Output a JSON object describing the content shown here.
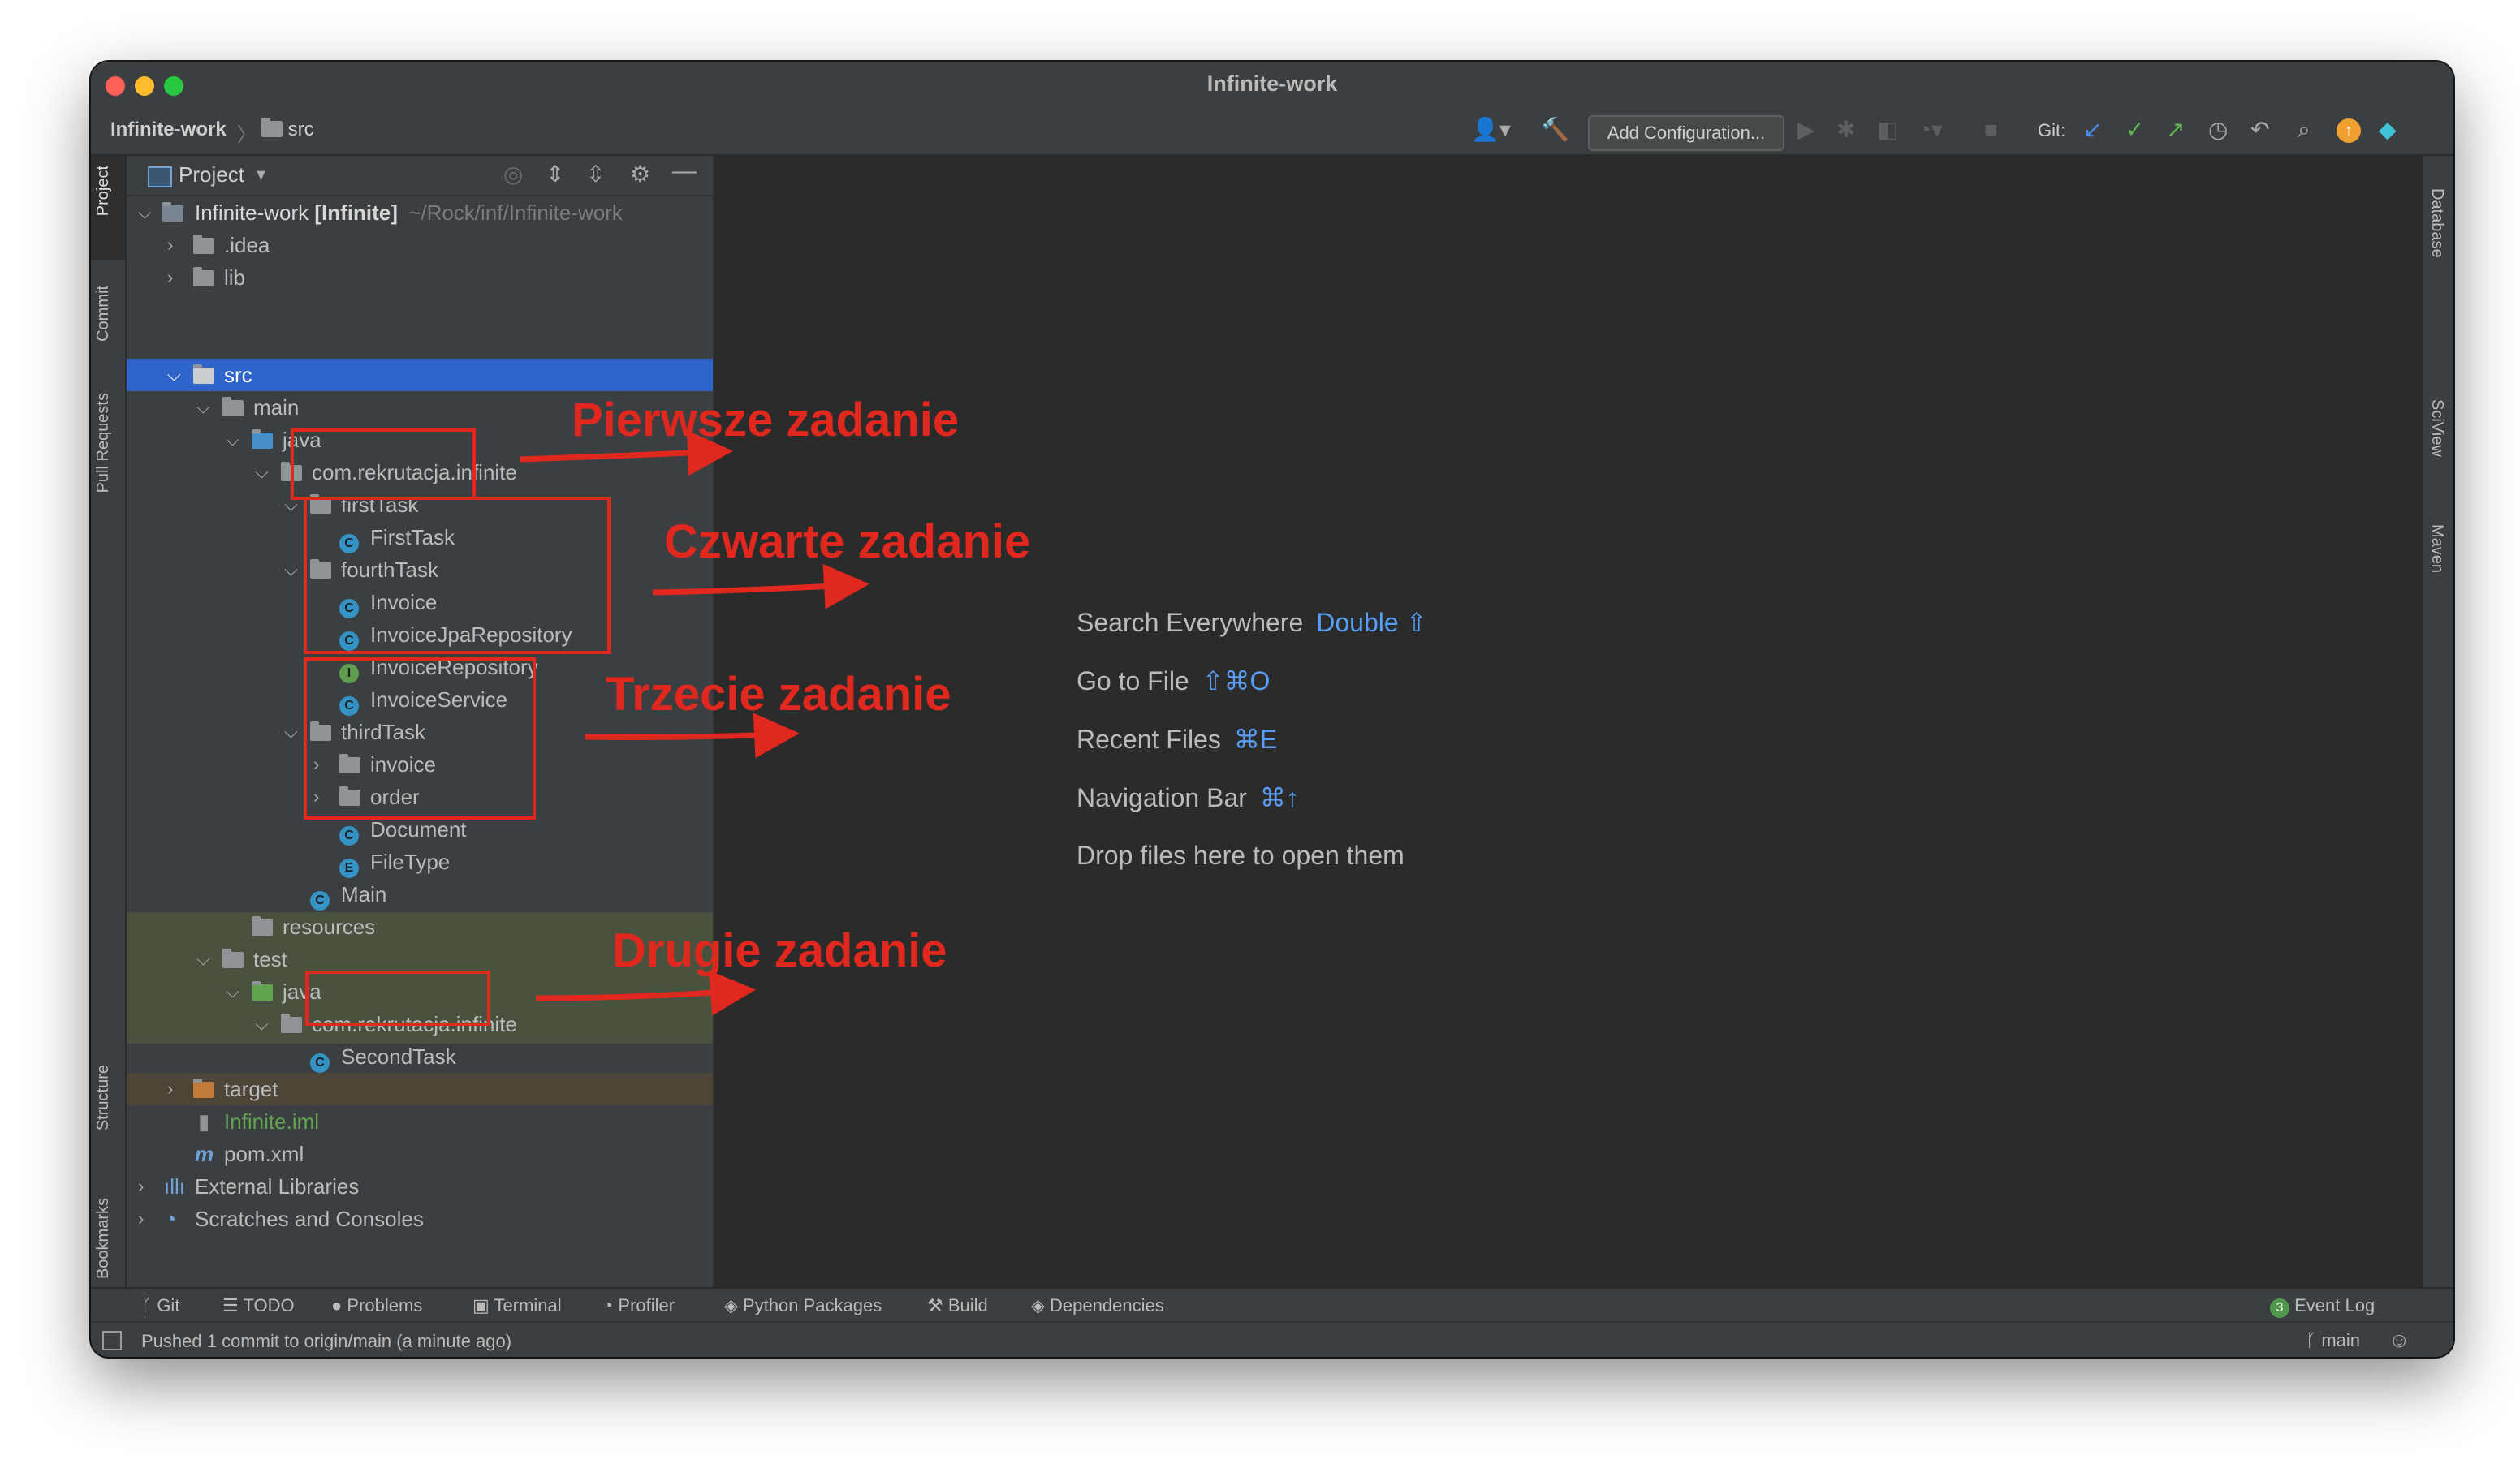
{
  "window": {
    "title": "Infinite-work"
  },
  "navbar": {
    "project": "Infinite-work",
    "folder": "src",
    "add_configuration": "Add Configuration...",
    "git_label": "Git:"
  },
  "left_tabs": [
    "Project",
    "Commit",
    "Pull Requests",
    "Structure",
    "Bookmarks"
  ],
  "right_tabs": [
    "Database",
    "SciView",
    "Maven"
  ],
  "project_panel": {
    "title": "Project",
    "tree": [
      {
        "label": "Infinite-work",
        "bold": "[Infinite]",
        "path": "~/Rock/inf/Infinite-work"
      },
      {
        "label": ".idea"
      },
      {
        "label": "lib"
      },
      {
        "label": "src"
      },
      {
        "label": "main"
      },
      {
        "label": "java"
      },
      {
        "label": "com.rekrutacja.infinite"
      },
      {
        "label": "firstTask"
      },
      {
        "label": "FirstTask",
        "icon": "C"
      },
      {
        "label": "fourthTask"
      },
      {
        "label": "Invoice",
        "icon": "C"
      },
      {
        "label": "InvoiceJpaRepository",
        "icon": "C"
      },
      {
        "label": "InvoiceRepository",
        "icon": "I"
      },
      {
        "label": "InvoiceService",
        "icon": "C"
      },
      {
        "label": "thirdTask"
      },
      {
        "label": "invoice"
      },
      {
        "label": "order"
      },
      {
        "label": "Document",
        "icon": "C"
      },
      {
        "label": "FileType",
        "icon": "E"
      },
      {
        "label": "Main",
        "icon": "C"
      },
      {
        "label": "resources"
      },
      {
        "label": "test"
      },
      {
        "label": "java"
      },
      {
        "label": "com.rekrutacja.infinite"
      },
      {
        "label": "SecondTask",
        "icon": "C"
      },
      {
        "label": "target"
      },
      {
        "label": "Infinite.iml"
      },
      {
        "label": "pom.xml"
      },
      {
        "label": "External Libraries"
      },
      {
        "label": "Scratches and Consoles"
      }
    ]
  },
  "editor_hints": [
    {
      "label": "Search Everywhere",
      "key": "Double ⇧"
    },
    {
      "label": "Go to File",
      "key": "⇧⌘O"
    },
    {
      "label": "Recent Files",
      "key": "⌘E"
    },
    {
      "label": "Navigation Bar",
      "key": "⌘↑"
    },
    {
      "label": "Drop files here to open them",
      "key": ""
    }
  ],
  "tool_windows": [
    "Git",
    "TODO",
    "Problems",
    "Terminal",
    "Profiler",
    "Python Packages",
    "Build",
    "Dependencies"
  ],
  "event_log": {
    "count": "3",
    "label": "Event Log"
  },
  "status": {
    "message": "Pushed 1 commit to origin/main (a minute ago)",
    "branch": "main"
  },
  "annotations": [
    "Pierwsze zadanie",
    "Czwarte zadanie",
    "Trzecie zadanie",
    "Drugie zadanie"
  ],
  "colors": {
    "accent": "#2f65ca",
    "annotation": "#e0281f",
    "test_bg": "#49523f"
  }
}
